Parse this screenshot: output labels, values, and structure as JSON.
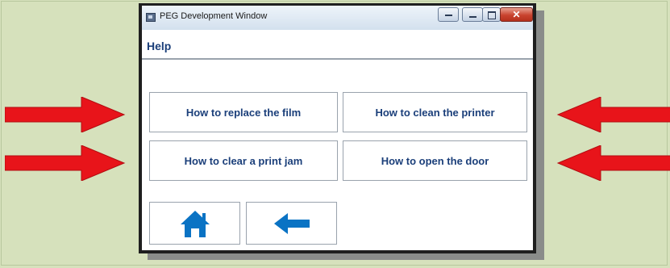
{
  "window": {
    "title": "PEG Development Window",
    "controls": {
      "minimize_icon": "minimize-icon",
      "maximize_icon": "maximize-icon",
      "close_icon": "close-icon",
      "close_glyph": "✕"
    }
  },
  "header": {
    "title": "Help"
  },
  "help_buttons": [
    {
      "label": "How to replace the film"
    },
    {
      "label": "How to clean the printer"
    },
    {
      "label": "How to clear a print jam"
    },
    {
      "label": "How to open the door"
    }
  ],
  "nav": {
    "home_icon": "home-icon",
    "back_icon": "arrow-left-icon"
  },
  "annotations": {
    "arrow_color": "#e8141a",
    "arrow_icon": "red-arrow-icon"
  },
  "colors": {
    "background": "#d6e1bc",
    "label_text": "#1b3f7a",
    "icon_blue": "#0a73c4"
  }
}
